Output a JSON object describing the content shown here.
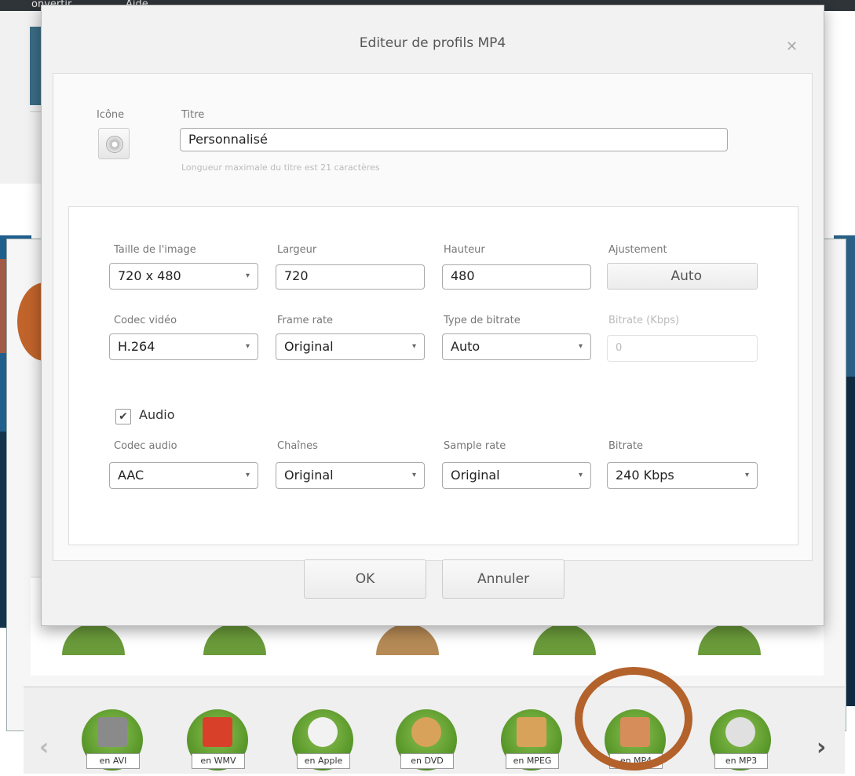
{
  "background": {
    "menubar": [
      "onvertir",
      "Aide"
    ],
    "formats": [
      {
        "label": "en AVI",
        "icon": "clapperboard-icon",
        "color": "#8a8a8a"
      },
      {
        "label": "en WMV",
        "icon": "wmv-icon",
        "color": "#d8402a"
      },
      {
        "label": "en Apple",
        "icon": "apple-icon",
        "color": "#f2f2f2"
      },
      {
        "label": "en DVD",
        "icon": "dvd-icon",
        "color": "#d9a25a"
      },
      {
        "label": "en MPEG",
        "icon": "tv-icon",
        "color": "#d9a25a"
      },
      {
        "label": "en MP4",
        "icon": "mp4-icon",
        "color": "#d68d5a"
      },
      {
        "label": "en MP3",
        "icon": "headphones-icon",
        "color": "#e0e0e0"
      }
    ],
    "prev_arrow": "‹",
    "next_arrow": "›",
    "highlight_color": "#b4622b"
  },
  "dialog": {
    "title": "Editeur de profils MP4",
    "close_glyph": "✕",
    "icon_label": "Icône",
    "title_label": "Titre",
    "title_value": "Personnalisé",
    "title_hint": "Longueur maximale du titre est 21 caractères",
    "video": {
      "size_label": "Taille de l'image",
      "size_value": "720 x 480",
      "width_label": "Largeur",
      "width_value": "720",
      "height_label": "Hauteur",
      "height_value": "480",
      "adjust_label": "Ajustement",
      "adjust_value": "Auto",
      "codec_label": "Codec vidéo",
      "codec_value": "H.264",
      "framerate_label": "Frame rate",
      "framerate_value": "Original",
      "bitrate_type_label": "Type de bitrate",
      "bitrate_type_value": "Auto",
      "bitrate_label": "Bitrate (Kbps)",
      "bitrate_value": "0"
    },
    "audio": {
      "enabled_label": "Audio",
      "checked": true,
      "check_glyph": "✔",
      "codec_label": "Codec audio",
      "codec_value": "AAC",
      "channels_label": "Chaînes",
      "channels_value": "Original",
      "samplerate_label": "Sample rate",
      "samplerate_value": "Original",
      "bitrate_label": "Bitrate",
      "bitrate_value": "240 Kbps"
    },
    "ok_label": "OK",
    "cancel_label": "Annuler",
    "caret": "▾"
  }
}
